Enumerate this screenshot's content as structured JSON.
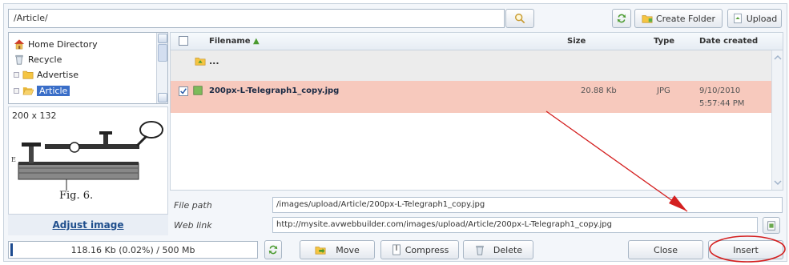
{
  "toolbar": {
    "path": "/Article/",
    "create_folder_label": "Create Folder",
    "upload_label": "Upload"
  },
  "tree": {
    "items": [
      {
        "label": "Home Directory",
        "icon": "home-icon"
      },
      {
        "label": "Recycle",
        "icon": "recycle-icon"
      },
      {
        "label": "Advertise",
        "icon": "folder-icon"
      },
      {
        "label": "Article",
        "icon": "folder-open-icon",
        "selected": true
      }
    ]
  },
  "preview": {
    "dimensions": "200 x 132",
    "image_caption": "Fig. 6.",
    "adjust_label": "Adjust image"
  },
  "table": {
    "headers": {
      "filename": "Filename",
      "size": "Size",
      "type": "Type",
      "date": "Date created"
    },
    "parent_row": "...",
    "rows": [
      {
        "name": "200px-L-Telegraph1_copy.jpg",
        "size": "20.88 Kb",
        "type": "JPG",
        "date": "9/10/2010",
        "time": "5:57:44 PM",
        "checked": true
      }
    ]
  },
  "details": {
    "file_path_label": "File path",
    "file_path": "/images/upload/Article/200px-L-Telegraph1_copy.jpg",
    "web_link_label": "Web link",
    "web_link": "http://mysite.avwebbuilder.com/images/upload/Article/200px-L-Telegraph1_copy.jpg"
  },
  "footer": {
    "quota": "118.16 Kb (0.02%) / 500 Mb",
    "quota_fraction": 0.0002,
    "move_label": "Move",
    "compress_label": "Compress",
    "delete_label": "Delete",
    "close_label": "Close",
    "insert_label": "Insert"
  },
  "colors": {
    "selected_row": "#f7c9bd",
    "tree_selection": "#3a6ec8",
    "annotation_red": "#d42020"
  }
}
